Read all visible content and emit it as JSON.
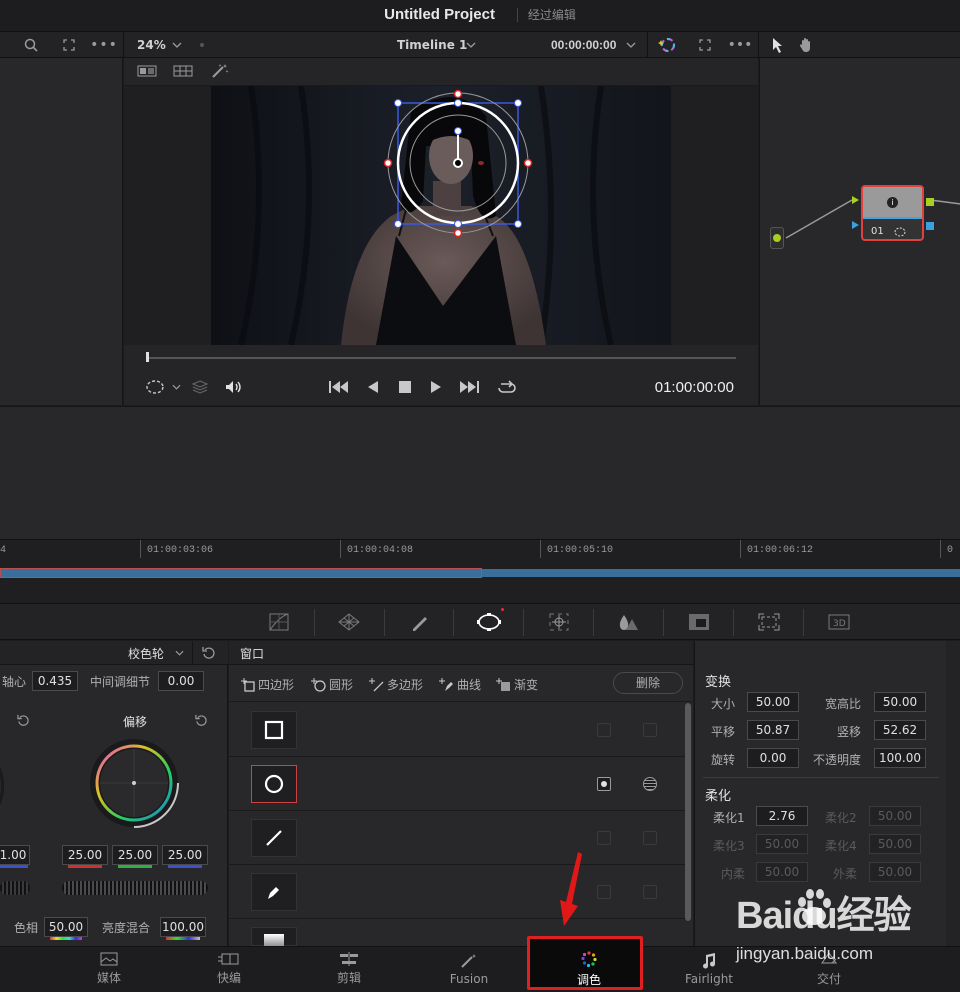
{
  "title": {
    "project": "Untitled Project",
    "status": "经过编辑"
  },
  "toolbar": {
    "zoom": "24%",
    "timeline_name": "Timeline 1",
    "timecode": "00:00:00:00"
  },
  "viewer": {
    "timecode": "01:00:00:00"
  },
  "node": {
    "label": "01"
  },
  "timeline": {
    "ruler": [
      {
        "label": "01:00:03:06"
      },
      {
        "label": "01:00:04:08"
      },
      {
        "label": "01:00:05:10"
      },
      {
        "label": "01:00:06:12"
      }
    ]
  },
  "wheels": {
    "mode": "校色轮",
    "pivot_label": "轴心",
    "pivot_value": "0.435",
    "detail_label": "中间调细节",
    "detail_value": "0.00",
    "offset_label": "偏移",
    "lift_partial_value": "1.00",
    "offset_values": [
      "25.00",
      "25.00",
      "25.00"
    ],
    "hue_label": "色相",
    "hue_value": "50.00",
    "lum_mix_label": "亮度混合",
    "lum_mix_value": "100.00"
  },
  "window_panel": {
    "title": "窗口",
    "tools": {
      "rect": "四边形",
      "circle": "圆形",
      "polygon": "多边形",
      "curve": "曲线",
      "gradient": "渐变"
    },
    "delete": "删除"
  },
  "transform": {
    "title": "变换",
    "size_label": "大小",
    "size_value": "50.00",
    "aspect_label": "宽高比",
    "aspect_value": "50.00",
    "pan_label": "平移",
    "pan_value": "50.87",
    "tilt_label": "竖移",
    "tilt_value": "52.62",
    "rotate_label": "旋转",
    "rotate_value": "0.00",
    "opacity_label": "不透明度",
    "opacity_value": "100.00",
    "soft_title": "柔化",
    "soft1_label": "柔化1",
    "soft1_value": "2.76",
    "soft2_label": "柔化2",
    "soft2_value": "50.00",
    "soft3_label": "柔化3",
    "soft3_value": "50.00",
    "soft4_label": "柔化4",
    "soft4_value": "50.00",
    "inside_label": "内柔",
    "inside_value": "50.00",
    "outside_label": "外柔",
    "outside_value": "50.00"
  },
  "pages": [
    {
      "label": "媒体",
      "icon": "media-icon"
    },
    {
      "label": "快编",
      "icon": "cut-icon"
    },
    {
      "label": "剪辑",
      "icon": "edit-icon"
    },
    {
      "label": "Fusion",
      "icon": "fusion-icon"
    },
    {
      "label": "调色",
      "icon": "color-icon"
    },
    {
      "label": "Fairlight",
      "icon": "fairlight-icon"
    },
    {
      "label": "交付",
      "icon": "deliver-icon"
    }
  ],
  "watermark": {
    "brand": "Baidu经验",
    "url": "jingyan.baidu.com"
  },
  "colors": {
    "highlight": "#e02020",
    "clip": "#3a6f9c",
    "window_outline": "#ffffff",
    "bbox": "#3a5adf"
  }
}
